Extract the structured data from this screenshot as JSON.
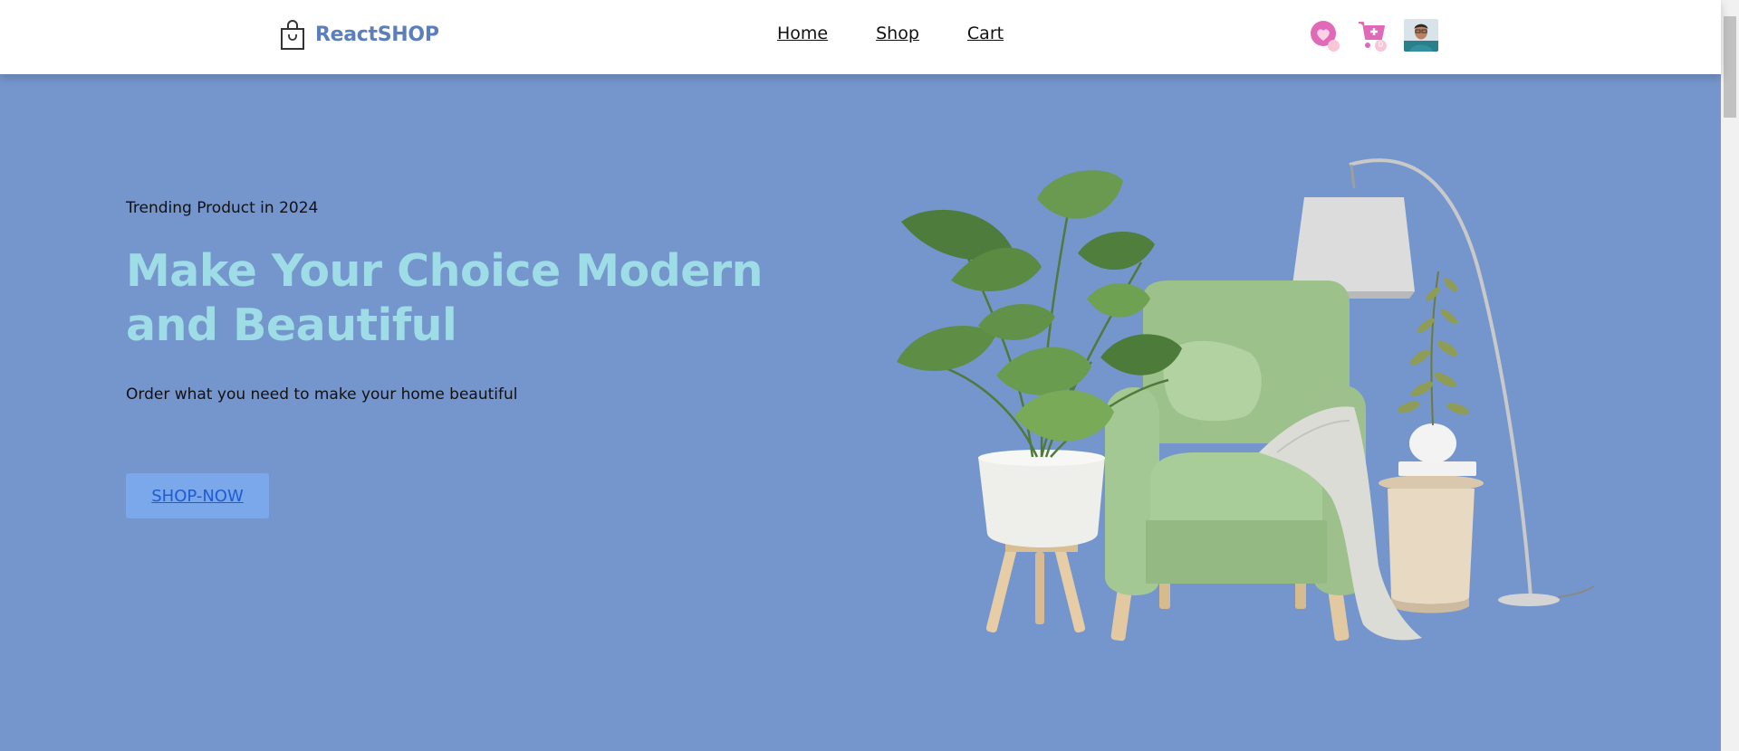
{
  "brand": {
    "name": "ReactSHOP",
    "icon": "shopping-bag-icon",
    "color": "#5b7fbd"
  },
  "nav": {
    "items": [
      {
        "label": "Home"
      },
      {
        "label": "Shop"
      },
      {
        "label": "Cart"
      }
    ]
  },
  "header_icons": {
    "wishlist": {
      "icon": "heart-icon",
      "badge": ""
    },
    "cart": {
      "icon": "cart-plus-icon",
      "badge": "0"
    },
    "profile": {
      "icon": "user-avatar"
    }
  },
  "hero": {
    "tagline": "Trending Product in 2024",
    "title": "Make Your Choice Modern and Beautiful",
    "subtitle": "Order what you need to make your home beautiful",
    "cta_label": "SHOP-NOW",
    "image": "furniture-hero-illustration"
  },
  "colors": {
    "hero_background": "#7596cd",
    "title": "#9fdde6",
    "cta_background": "#7aa8ea",
    "cta_text": "#1f5bd6",
    "accent_pink": "#e06ab8"
  }
}
